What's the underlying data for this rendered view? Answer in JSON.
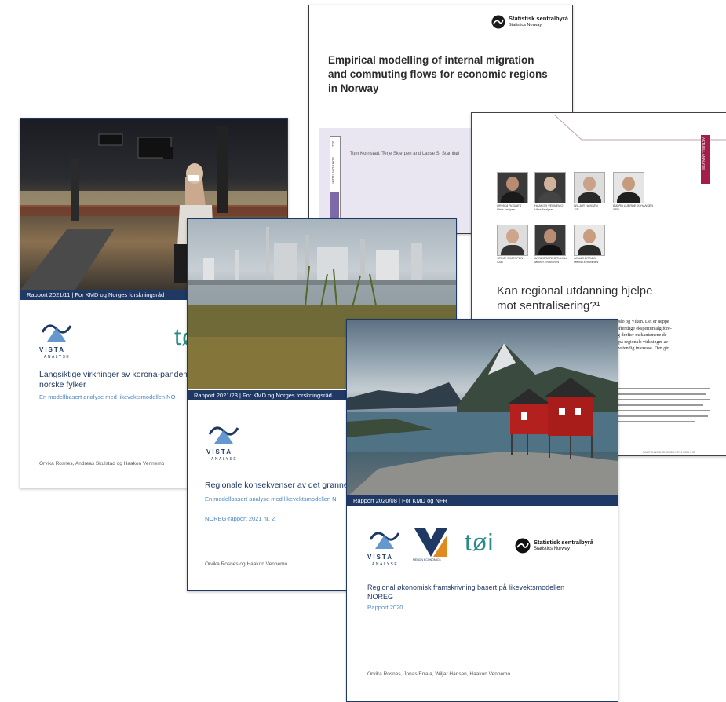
{
  "ssb_report": {
    "logo_name": "Statistisk sentralbyrå",
    "logo_sub": "Statistics Norway",
    "title_line1": "Empirical modelling of internal migration",
    "title_line2": "and commuting flows for economic regions",
    "title_line3": "in Norway",
    "authors": "Tom Kornstad, Terje Skjerpen and Lasse S. Stambøl",
    "side_tab1": "TALL",
    "side_tab2": "SOM FORTELLER"
  },
  "article": {
    "tab": "AKTUELL ANALYSE",
    "title_line1": "Kan regional utdanning hjelpe",
    "title_line2": "mot sentralisering?¹",
    "people": [
      {
        "name": "ORVIKA ROSNES",
        "org": "Vista Analyse"
      },
      {
        "name": "HAAKON VENNEMO",
        "org": "Vista Analyse"
      },
      {
        "name": "WILJAR HANSEN",
        "org": "TØI"
      },
      {
        "name": "BJØRN GJERDE JOHANSEN",
        "org": "SSB"
      },
      {
        "name": "TERJE SKJERPEN",
        "org": "SSB"
      },
      {
        "name": "ANNEGRETE BRUVOLL",
        "org": "Menon Economics"
      },
      {
        "name": "JONAS ERRAIA",
        "org": "Menon Economics"
      }
    ],
    "body_lines": [
      "skjedd i Oslo og Viken. Det er neppe",
      "har flere offentlige ekspertutvalg fore-",
      "to tiltak og drøfter mekanismene de",
      "e som ser på regionale virkninger av",
      "kan ha selvstendig interesse. Den gir"
    ],
    "footer": "SAMFUNNSØKONOMEN NR. 4 2021 // 35"
  },
  "report1": {
    "bar": "Rapport 2021/11  |  For KMD og Norges forskningsråd",
    "vista_logo": "VISTA",
    "vista_logo_sub": "ANALYSE",
    "toi_logo": "tø",
    "title_line1": "Langsiktige virkninger av korona-pandem",
    "title_line2": "norske fylker",
    "subtitle": "En modellbasert analyse med likevektsmodellen NO",
    "authors": "Orvika Rosnes, Andreas Skulstad og Haakon Vennemo"
  },
  "report2": {
    "bar": "Rapport 2021/23  |  For KMD og Norges forskningsråd",
    "vista_logo": "VISTA",
    "vista_logo_sub": "ANALYSE",
    "title": "Regionale konsekvenser av det grønne",
    "subtitle": "En modellbasert analyse med likevektsmodellen N",
    "series": "NOREG-rapport 2021 nr. 2",
    "authors": "Orvika Rosnes og Haakon Vennemo"
  },
  "report3": {
    "bar": "Rapport 2020/08  |  For KMD og NFR",
    "vista_logo": "VISTA",
    "vista_logo_sub": "ANALYSE",
    "menon_logo": "MENON ECONOMICS",
    "toi_logo": "tøi",
    "ssb_logo_name": "Statistisk sentralbyrå",
    "ssb_logo_sub": "Statistics Norway",
    "title_line1": "Regional økonomisk framskrivning basert på likevektsmodellen",
    "title_line2": "NOREG",
    "subtitle": "Rapport 2020",
    "authors": "Orvika Rosnes, Jonas Erraia, Wiljar Hansen, Haakon Vennemo"
  },
  "colors": {
    "navy": "#1f3864",
    "vista_blue": "#4a86c5",
    "toi_teal": "#2a8a8c",
    "ssb_lavender": "#e9e6f2",
    "ssb_purple": "#7d6aa8",
    "article_tab": "#a11f4a",
    "barn_red": "#b3201d"
  }
}
